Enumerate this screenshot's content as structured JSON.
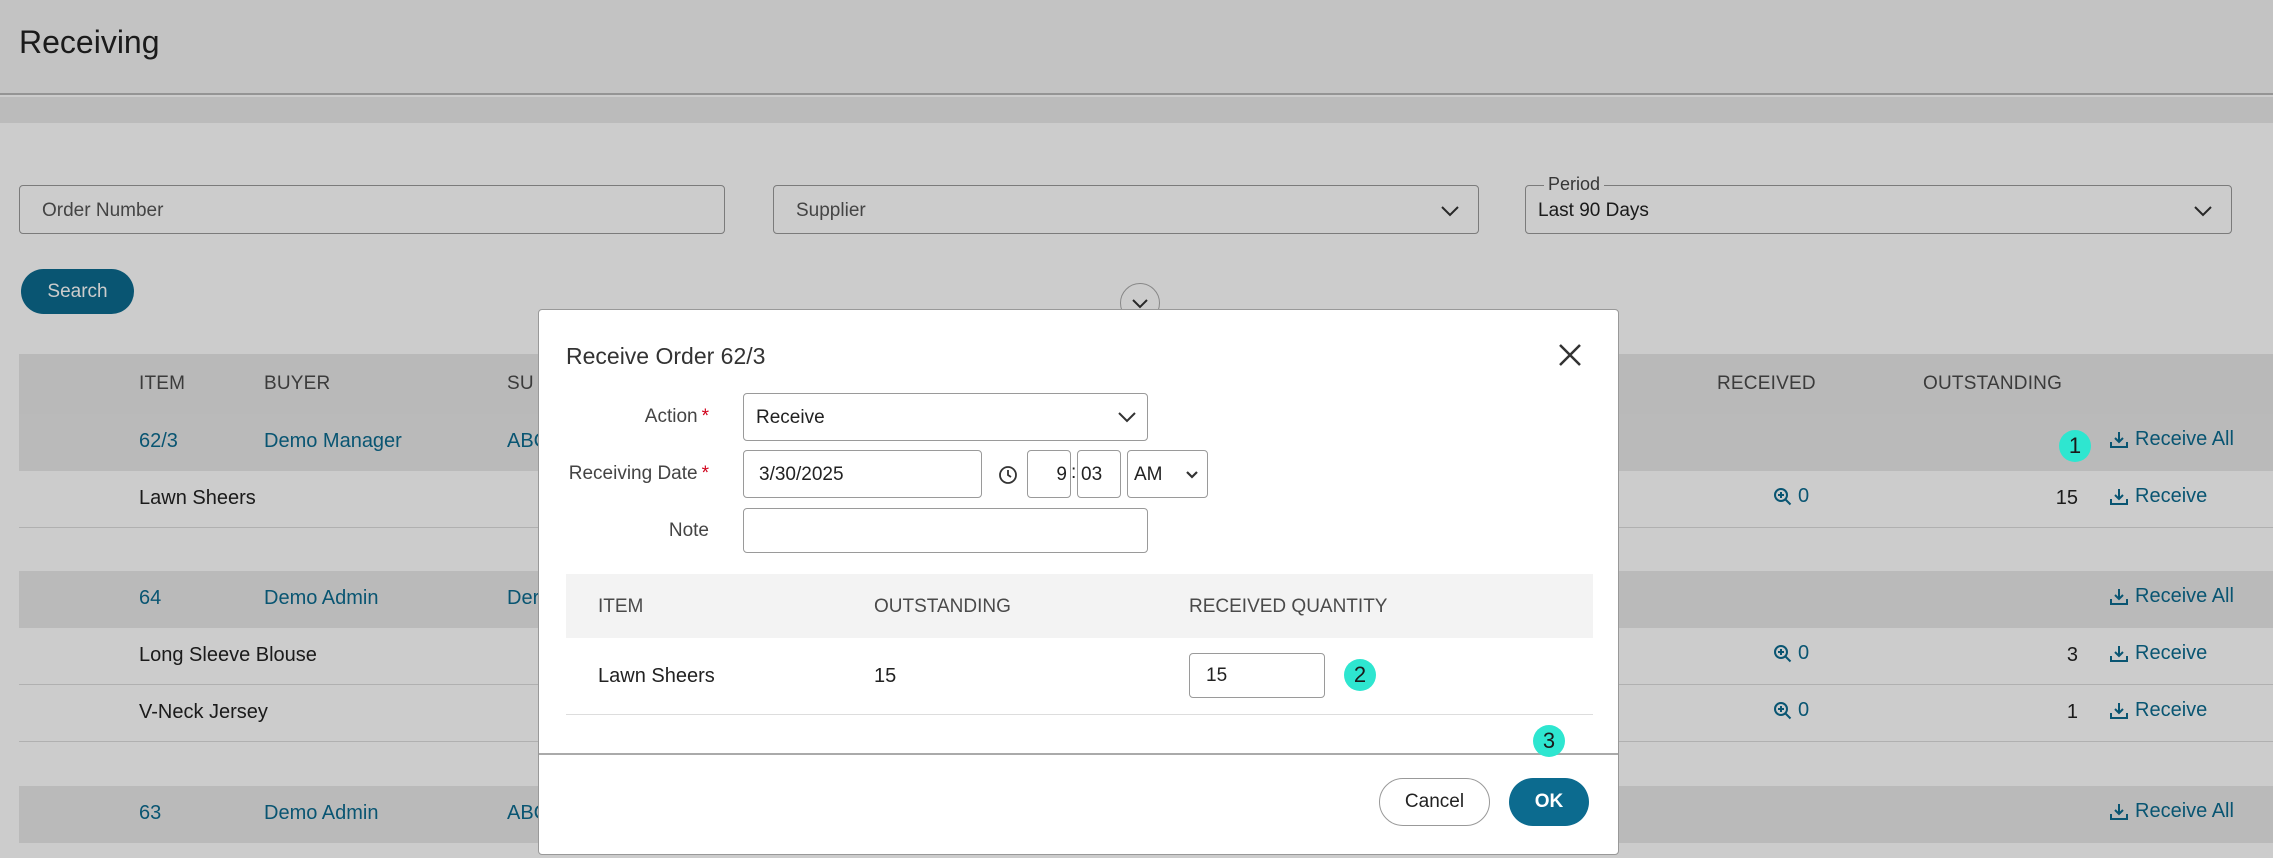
{
  "page": {
    "title": "Receiving"
  },
  "filters": {
    "order_number_placeholder": "Order Number",
    "supplier_placeholder": "Supplier",
    "period_label": "Period",
    "period_value": "Last 90 Days",
    "search_label": "Search"
  },
  "table": {
    "headers": {
      "item": "ITEM",
      "buyer": "BUYER",
      "supplier": "SU",
      "received": "RECEIVED",
      "outstanding": "OUTSTANDING"
    },
    "receive_all_label": "Receive All",
    "receive_label": "Receive",
    "orders": [
      {
        "number": "62/3",
        "buyer": "Demo Manager",
        "supplier": "ABC",
        "items": [
          {
            "name": "Lawn Sheers",
            "received": "0",
            "outstanding": "15"
          }
        ]
      },
      {
        "number": "64",
        "buyer": "Demo Admin",
        "supplier": "Der",
        "items": [
          {
            "name": "Long Sleeve Blouse",
            "received": "0",
            "outstanding": "3"
          },
          {
            "name": "V-Neck Jersey",
            "received": "0",
            "outstanding": "1"
          }
        ]
      },
      {
        "number": "63",
        "buyer": "Demo Admin",
        "supplier": "ABC",
        "items": []
      }
    ]
  },
  "modal": {
    "title": "Receive Order 62/3",
    "action_label": "Action",
    "action_value": "Receive",
    "date_label": "Receiving Date",
    "date_value": "3/30/2025",
    "hour": "9",
    "time_sep": ":",
    "minute": "03",
    "ampm": "AM",
    "note_label": "Note",
    "note_value": "",
    "required_mark": "*",
    "headers": {
      "item": "ITEM",
      "outstanding": "OUTSTANDING",
      "received_quantity": "RECEIVED QUANTITY"
    },
    "row": {
      "item": "Lawn Sheers",
      "outstanding": "15",
      "received_quantity": "15"
    },
    "cancel_label": "Cancel",
    "ok_label": "OK"
  },
  "markers": {
    "m1": "1",
    "m2": "2",
    "m3": "3"
  },
  "colors": {
    "accent": "#0c6b8f",
    "marker": "#2ee6d0",
    "required": "#d0021b"
  }
}
